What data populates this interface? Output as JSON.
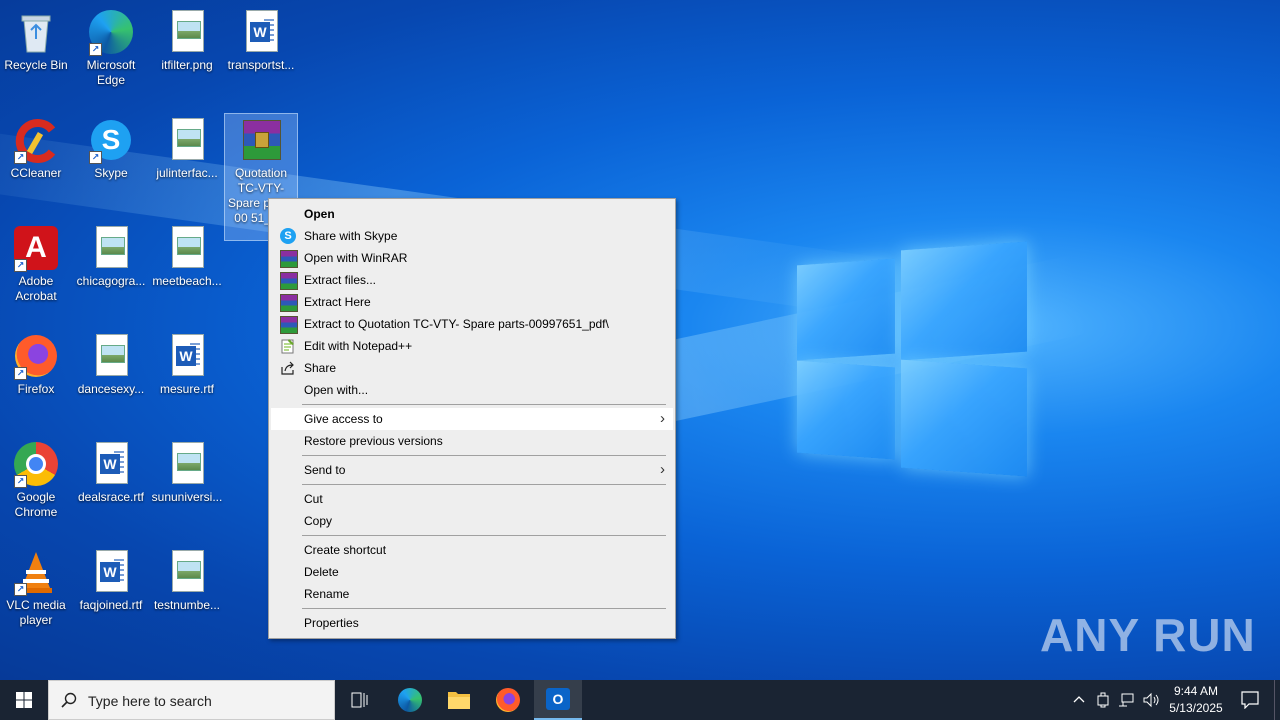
{
  "desktop": {
    "icons": [
      {
        "label": "Recycle Bin"
      },
      {
        "label": "Microsoft Edge"
      },
      {
        "label": "itfilter.png"
      },
      {
        "label": "transportst..."
      },
      {
        "label": "CCleaner"
      },
      {
        "label": "Skype"
      },
      {
        "label": "julinterfac..."
      },
      {
        "label": "Quotation TC-VTY- Spare parts-00 51_pdf"
      },
      {
        "label": "Adobe Acrobat"
      },
      {
        "label": "chicagogra..."
      },
      {
        "label": "meetbeach..."
      },
      {
        "label": "Firefox"
      },
      {
        "label": "dancesexy..."
      },
      {
        "label": "mesure.rtf"
      },
      {
        "label": "Google Chrome"
      },
      {
        "label": "dealsrace.rtf"
      },
      {
        "label": "sununiversi..."
      },
      {
        "label": "VLC media player"
      },
      {
        "label": "faqjoined.rtf"
      },
      {
        "label": "testnumbe..."
      }
    ]
  },
  "context_menu": {
    "items": [
      {
        "label": "Open"
      },
      {
        "label": "Share with Skype"
      },
      {
        "label": "Open with WinRAR"
      },
      {
        "label": "Extract files..."
      },
      {
        "label": "Extract Here"
      },
      {
        "label": "Extract to Quotation TC-VTY- Spare parts-00997651_pdf\\"
      },
      {
        "label": "Edit with Notepad++"
      },
      {
        "label": "Share"
      },
      {
        "label": "Open with..."
      },
      {
        "label": "Give access to"
      },
      {
        "label": "Restore previous versions"
      },
      {
        "label": "Send to"
      },
      {
        "label": "Cut"
      },
      {
        "label": "Copy"
      },
      {
        "label": "Create shortcut"
      },
      {
        "label": "Delete"
      },
      {
        "label": "Rename"
      },
      {
        "label": "Properties"
      }
    ]
  },
  "taskbar": {
    "search_placeholder": "Type here to search",
    "time": "9:44 AM",
    "date": "5/13/2025"
  },
  "watermark": "ANY RUN",
  "colors": {
    "accent": "#0a63d6",
    "taskbar": "#1a2433",
    "menu_bg": "#eeeeee"
  }
}
